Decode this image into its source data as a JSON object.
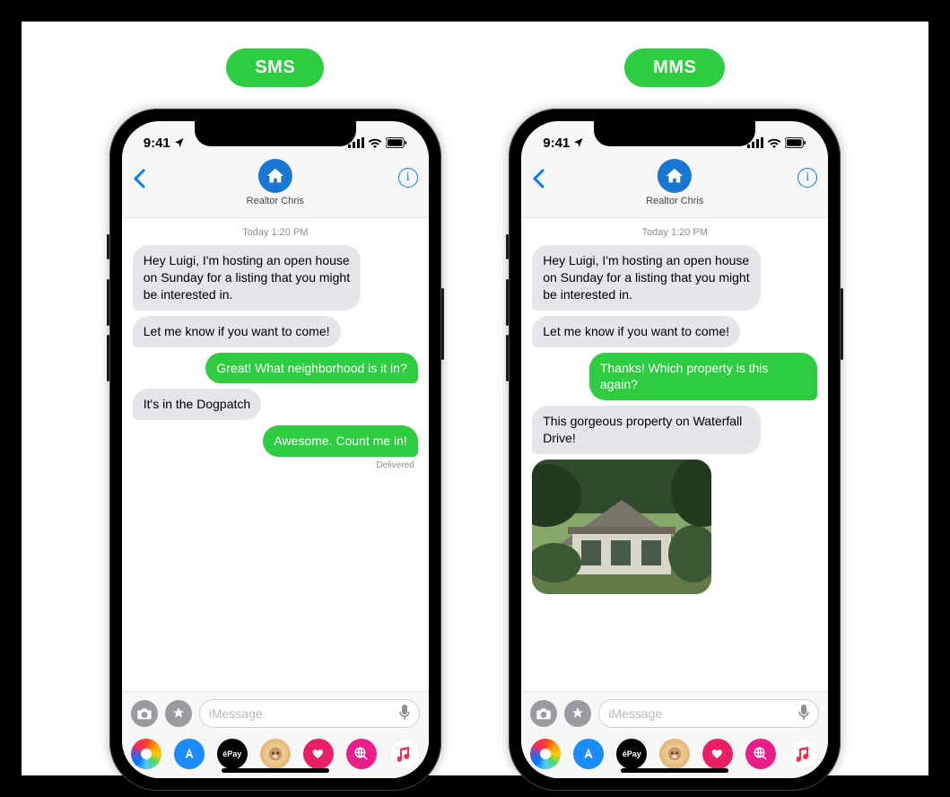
{
  "left": {
    "label": "SMS",
    "status_time": "9:41",
    "contact_name": "Realtor Chris",
    "timestamp": "Today 1:20 PM",
    "messages": [
      {
        "dir": "in",
        "text": "Hey Luigi, I'm hosting an open house on Sunday for a listing that you might be interested in."
      },
      {
        "dir": "in",
        "text": "Let me know if you want to come!"
      },
      {
        "dir": "out",
        "text": "Great! What neighborhood is it in?"
      },
      {
        "dir": "in",
        "text": "It's in the Dogpatch"
      },
      {
        "dir": "out",
        "text": "Awesome. Count me in!"
      }
    ],
    "delivered": "Delivered",
    "input_placeholder": "iMessage"
  },
  "right": {
    "label": "MMS",
    "status_time": "9:41",
    "contact_name": "Realtor Chris",
    "timestamp": "Today 1:20 PM",
    "messages": [
      {
        "dir": "in",
        "text": "Hey Luigi, I'm hosting an open house on Sunday for a listing that you might be interested in."
      },
      {
        "dir": "in",
        "text": "Let me know if you want to come!"
      },
      {
        "dir": "out",
        "text": "Thanks! Which property is this again?"
      },
      {
        "dir": "in",
        "text": "This gorgeous property on Waterfall Drive!"
      }
    ],
    "image_note": "house-photo",
    "input_placeholder": "iMessage"
  },
  "apps": {
    "pay_label": "éPay"
  },
  "colors": {
    "green_bubble": "#2ecc40",
    "gray_bubble": "#e5e5ea",
    "ios_blue": "#007aff"
  }
}
